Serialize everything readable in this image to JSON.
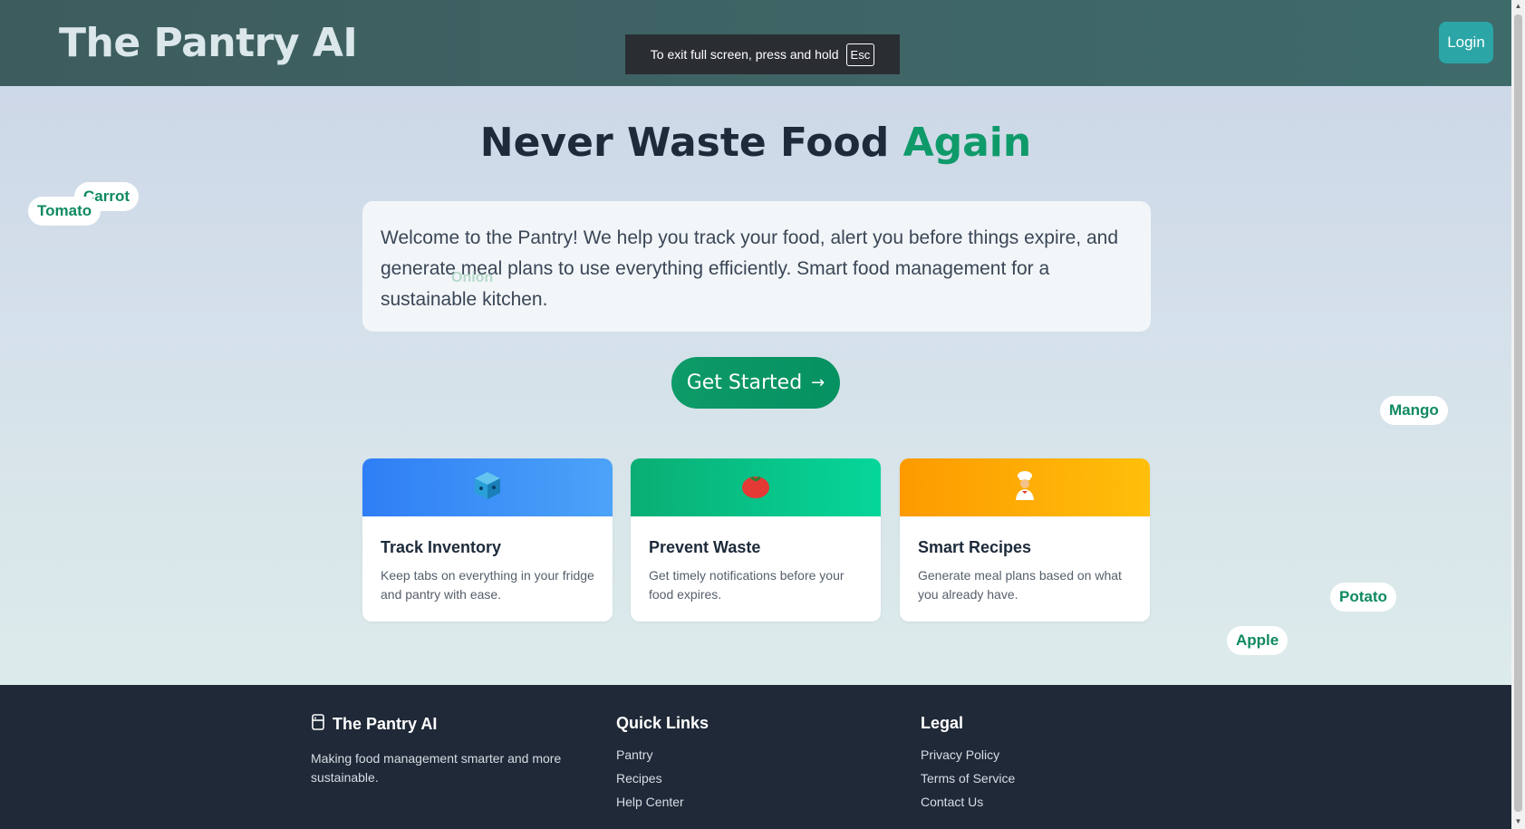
{
  "header": {
    "brand": "The Pantry AI",
    "login_label": "Login"
  },
  "fullscreen_toast": {
    "text": "To exit full screen, press and hold",
    "key": "Esc"
  },
  "hero": {
    "title_main": "Never Waste Food ",
    "title_accent": "Again",
    "welcome_text": "Welcome to the Pantry! We help you track your food, alert you before things expire, and generate meal plans to use everything efficiently. Smart food management for a sustainable kitchen.",
    "cta_label": "Get Started",
    "cta_icon": "→"
  },
  "floating_tags": {
    "tomato": "Tomato",
    "carrot": "Carrot",
    "onion": "Onion",
    "mango": "Mango",
    "potato": "Potato",
    "apple": "Apple"
  },
  "features": [
    {
      "title": "Track Inventory",
      "desc": "Keep tabs on everything in your fridge and pantry with ease.",
      "icon": "box-icon",
      "color_from": "#2f7ef5",
      "color_to": "#4ca3f8"
    },
    {
      "title": "Prevent Waste",
      "desc": "Get timely notifications before your food expires.",
      "icon": "tomato-icon",
      "color_from": "#0aae74",
      "color_to": "#06d69a"
    },
    {
      "title": "Smart Recipes",
      "desc": "Generate meal plans based on what you already have.",
      "icon": "chef-icon",
      "color_from": "#fd9a00",
      "color_to": "#ffbf0a"
    }
  ],
  "footer": {
    "brand": "The Pantry AI",
    "brand_icon": "pantry-icon",
    "tagline": "Making food management smarter and more sustainable.",
    "quick_links_heading": "Quick Links",
    "quick_links": [
      "Pantry",
      "Recipes",
      "Help Center"
    ],
    "legal_heading": "Legal",
    "legal_links": [
      "Privacy Policy",
      "Terms of Service",
      "Contact Us"
    ]
  }
}
